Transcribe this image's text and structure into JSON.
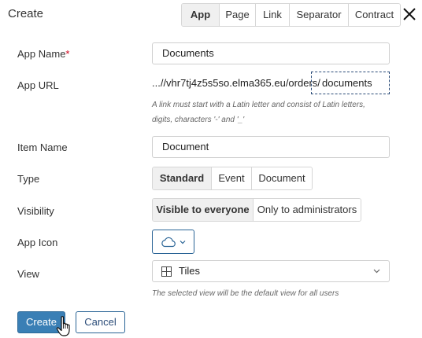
{
  "dialog": {
    "title": "Create"
  },
  "type_tabs": [
    {
      "label": "App",
      "active": true
    },
    {
      "label": "Page",
      "active": false
    },
    {
      "label": "Link",
      "active": false
    },
    {
      "label": "Separator",
      "active": false
    },
    {
      "label": "Contract",
      "active": false
    }
  ],
  "form": {
    "app_name": {
      "label": "App Name",
      "required_mark": "*",
      "value": "Documents"
    },
    "app_url": {
      "label": "App URL",
      "prefix": "...//vhr7tj4z5s5so.elma365.eu/orders/",
      "value": "documents",
      "hint_line1": "A link must start with a Latin letter and consist of Latin letters,",
      "hint_line2": "digits, characters '-' and '_'"
    },
    "item_name": {
      "label": "Item Name",
      "value": "Document"
    },
    "type": {
      "label": "Type",
      "options": [
        {
          "label": "Standard",
          "active": true
        },
        {
          "label": "Event",
          "active": false
        },
        {
          "label": "Document",
          "active": false
        }
      ]
    },
    "visibility": {
      "label": "Visibility",
      "options": [
        {
          "label": "Visible to everyone",
          "active": true
        },
        {
          "label": "Only to administrators",
          "active": false
        }
      ]
    },
    "app_icon": {
      "label": "App Icon",
      "icon": "cloud-icon"
    },
    "view": {
      "label": "View",
      "selected": "Tiles",
      "icon": "tiles-grid-icon",
      "hint": "The selected view will be the default view for all users"
    }
  },
  "actions": {
    "create_label": "Create",
    "cancel_label": "Cancel"
  },
  "colors": {
    "primary": "#3a7fb5",
    "outline": "#2a6496",
    "required": "#d0021b",
    "active_segment": "#f0f0f0"
  }
}
